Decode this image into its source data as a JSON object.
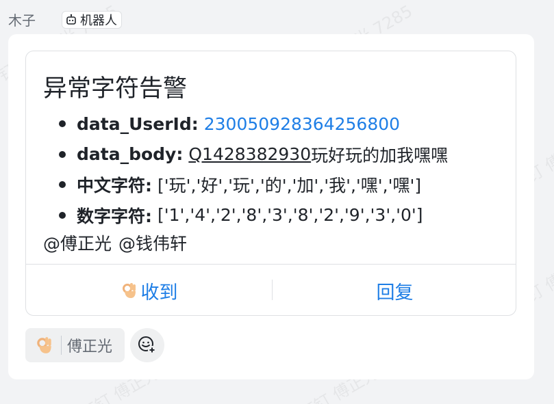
{
  "header": {
    "sender": "木子",
    "bot_tag": "机器人"
  },
  "watermark": "钉钉 傅正光 7285",
  "card": {
    "title": "异常字符告警",
    "fields": [
      {
        "label": "data_UserId:",
        "value": "230050928364256800"
      },
      {
        "label": "data_body:",
        "value_underlined": "Q1428382930",
        "value_rest": "玩好玩的加我嘿嘿"
      },
      {
        "label": "中文字符:",
        "value": "['玩','好','玩','的','加','我','嘿','嘿']"
      },
      {
        "label": "数字字符:",
        "value": "['1','4','2','8','3','8','2','9','3','0']"
      }
    ],
    "mentions": [
      "@傅正光",
      "@钱伟轩"
    ],
    "actions": {
      "received": "收到",
      "reply": "回复"
    }
  },
  "reaction": {
    "emoji_icon": "ok-hand-icon",
    "user": "傅正光"
  },
  "colors": {
    "link": "#1e7ee6",
    "background": "#f2f3f5"
  }
}
